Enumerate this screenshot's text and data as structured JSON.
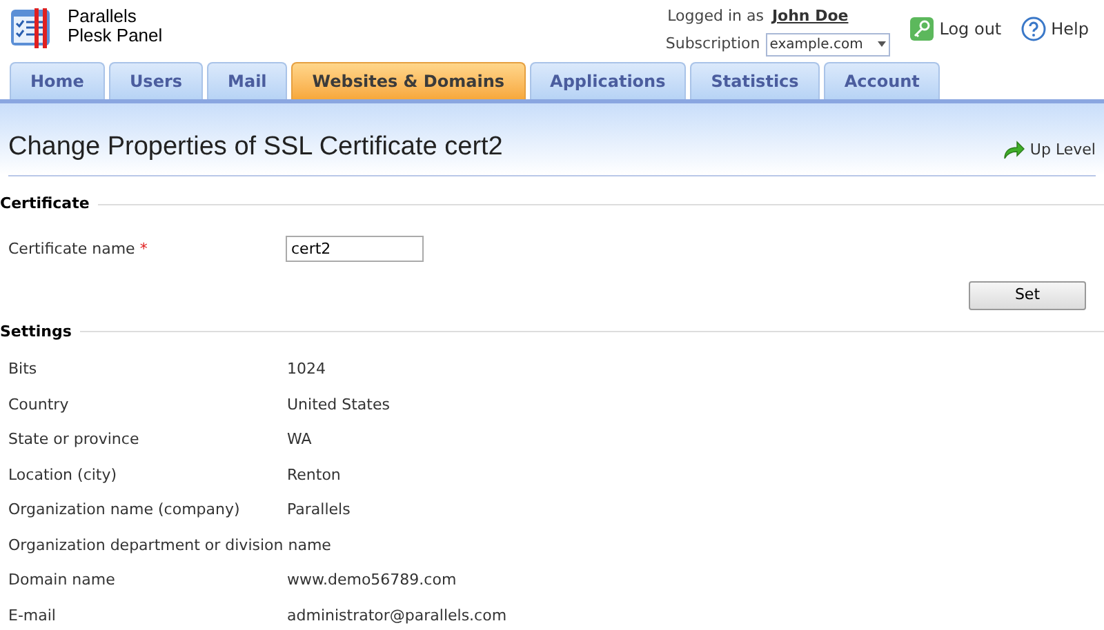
{
  "brand": {
    "line_1": "Parallels",
    "line_2": "Plesk Panel"
  },
  "user": {
    "logged_in_label": "Logged in as",
    "name": "John Doe",
    "subscription_label": "Subscription",
    "subscription": "example.com"
  },
  "header_links": [
    {
      "kind": "logout",
      "label": "Log out"
    },
    {
      "kind": "help",
      "label": "Help"
    }
  ],
  "tabs": [
    {
      "label": "Home",
      "selected": false
    },
    {
      "label": "Users",
      "selected": false
    },
    {
      "label": "Mail",
      "selected": false
    },
    {
      "label": "Websites & Domains",
      "selected": true
    },
    {
      "label": "Applications",
      "selected": false
    },
    {
      "label": "Statistics",
      "selected": false
    },
    {
      "label": "Account",
      "selected": false
    }
  ],
  "page": {
    "title": "Change Properties of SSL Certificate cert2",
    "up_level": "Up Level"
  },
  "certificate": {
    "heading": "Certificate",
    "name_label": "Certificate name",
    "required_mark": "*",
    "name_value": "cert2",
    "button": "Set"
  },
  "settings": {
    "heading": "Settings",
    "rows": [
      {
        "label": "Bits",
        "value": "1024"
      },
      {
        "label": "Country",
        "value": "United States"
      },
      {
        "label": "State or province",
        "value": "WA"
      },
      {
        "label": "Location (city)",
        "value": "Renton"
      },
      {
        "label": "Organization name (company)",
        "value": "Parallels"
      },
      {
        "label": "Organization department or division name"
      },
      {
        "label": "Domain name",
        "value": "www.demo56789.com"
      },
      {
        "label": "E-mail",
        "value": "administrator@parallels.com"
      }
    ]
  }
}
